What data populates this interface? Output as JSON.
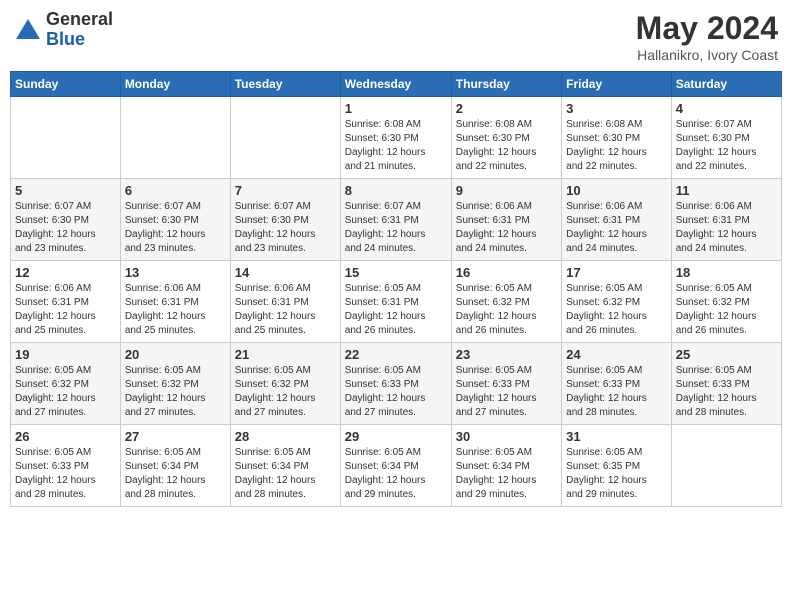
{
  "header": {
    "logo_general": "General",
    "logo_blue": "Blue",
    "month_year": "May 2024",
    "location": "Hallanikro, Ivory Coast"
  },
  "weekdays": [
    "Sunday",
    "Monday",
    "Tuesday",
    "Wednesday",
    "Thursday",
    "Friday",
    "Saturday"
  ],
  "weeks": [
    {
      "row_class": "week-row-odd",
      "days": [
        {
          "num": "",
          "info": ""
        },
        {
          "num": "",
          "info": ""
        },
        {
          "num": "",
          "info": ""
        },
        {
          "num": "1",
          "info": "Sunrise: 6:08 AM\nSunset: 6:30 PM\nDaylight: 12 hours\nand 21 minutes."
        },
        {
          "num": "2",
          "info": "Sunrise: 6:08 AM\nSunset: 6:30 PM\nDaylight: 12 hours\nand 22 minutes."
        },
        {
          "num": "3",
          "info": "Sunrise: 6:08 AM\nSunset: 6:30 PM\nDaylight: 12 hours\nand 22 minutes."
        },
        {
          "num": "4",
          "info": "Sunrise: 6:07 AM\nSunset: 6:30 PM\nDaylight: 12 hours\nand 22 minutes."
        }
      ]
    },
    {
      "row_class": "week-row-even",
      "days": [
        {
          "num": "5",
          "info": "Sunrise: 6:07 AM\nSunset: 6:30 PM\nDaylight: 12 hours\nand 23 minutes."
        },
        {
          "num": "6",
          "info": "Sunrise: 6:07 AM\nSunset: 6:30 PM\nDaylight: 12 hours\nand 23 minutes."
        },
        {
          "num": "7",
          "info": "Sunrise: 6:07 AM\nSunset: 6:30 PM\nDaylight: 12 hours\nand 23 minutes."
        },
        {
          "num": "8",
          "info": "Sunrise: 6:07 AM\nSunset: 6:31 PM\nDaylight: 12 hours\nand 24 minutes."
        },
        {
          "num": "9",
          "info": "Sunrise: 6:06 AM\nSunset: 6:31 PM\nDaylight: 12 hours\nand 24 minutes."
        },
        {
          "num": "10",
          "info": "Sunrise: 6:06 AM\nSunset: 6:31 PM\nDaylight: 12 hours\nand 24 minutes."
        },
        {
          "num": "11",
          "info": "Sunrise: 6:06 AM\nSunset: 6:31 PM\nDaylight: 12 hours\nand 24 minutes."
        }
      ]
    },
    {
      "row_class": "week-row-odd",
      "days": [
        {
          "num": "12",
          "info": "Sunrise: 6:06 AM\nSunset: 6:31 PM\nDaylight: 12 hours\nand 25 minutes."
        },
        {
          "num": "13",
          "info": "Sunrise: 6:06 AM\nSunset: 6:31 PM\nDaylight: 12 hours\nand 25 minutes."
        },
        {
          "num": "14",
          "info": "Sunrise: 6:06 AM\nSunset: 6:31 PM\nDaylight: 12 hours\nand 25 minutes."
        },
        {
          "num": "15",
          "info": "Sunrise: 6:05 AM\nSunset: 6:31 PM\nDaylight: 12 hours\nand 26 minutes."
        },
        {
          "num": "16",
          "info": "Sunrise: 6:05 AM\nSunset: 6:32 PM\nDaylight: 12 hours\nand 26 minutes."
        },
        {
          "num": "17",
          "info": "Sunrise: 6:05 AM\nSunset: 6:32 PM\nDaylight: 12 hours\nand 26 minutes."
        },
        {
          "num": "18",
          "info": "Sunrise: 6:05 AM\nSunset: 6:32 PM\nDaylight: 12 hours\nand 26 minutes."
        }
      ]
    },
    {
      "row_class": "week-row-even",
      "days": [
        {
          "num": "19",
          "info": "Sunrise: 6:05 AM\nSunset: 6:32 PM\nDaylight: 12 hours\nand 27 minutes."
        },
        {
          "num": "20",
          "info": "Sunrise: 6:05 AM\nSunset: 6:32 PM\nDaylight: 12 hours\nand 27 minutes."
        },
        {
          "num": "21",
          "info": "Sunrise: 6:05 AM\nSunset: 6:32 PM\nDaylight: 12 hours\nand 27 minutes."
        },
        {
          "num": "22",
          "info": "Sunrise: 6:05 AM\nSunset: 6:33 PM\nDaylight: 12 hours\nand 27 minutes."
        },
        {
          "num": "23",
          "info": "Sunrise: 6:05 AM\nSunset: 6:33 PM\nDaylight: 12 hours\nand 27 minutes."
        },
        {
          "num": "24",
          "info": "Sunrise: 6:05 AM\nSunset: 6:33 PM\nDaylight: 12 hours\nand 28 minutes."
        },
        {
          "num": "25",
          "info": "Sunrise: 6:05 AM\nSunset: 6:33 PM\nDaylight: 12 hours\nand 28 minutes."
        }
      ]
    },
    {
      "row_class": "week-row-odd",
      "days": [
        {
          "num": "26",
          "info": "Sunrise: 6:05 AM\nSunset: 6:33 PM\nDaylight: 12 hours\nand 28 minutes."
        },
        {
          "num": "27",
          "info": "Sunrise: 6:05 AM\nSunset: 6:34 PM\nDaylight: 12 hours\nand 28 minutes."
        },
        {
          "num": "28",
          "info": "Sunrise: 6:05 AM\nSunset: 6:34 PM\nDaylight: 12 hours\nand 28 minutes."
        },
        {
          "num": "29",
          "info": "Sunrise: 6:05 AM\nSunset: 6:34 PM\nDaylight: 12 hours\nand 29 minutes."
        },
        {
          "num": "30",
          "info": "Sunrise: 6:05 AM\nSunset: 6:34 PM\nDaylight: 12 hours\nand 29 minutes."
        },
        {
          "num": "31",
          "info": "Sunrise: 6:05 AM\nSunset: 6:35 PM\nDaylight: 12 hours\nand 29 minutes."
        },
        {
          "num": "",
          "info": ""
        }
      ]
    }
  ]
}
